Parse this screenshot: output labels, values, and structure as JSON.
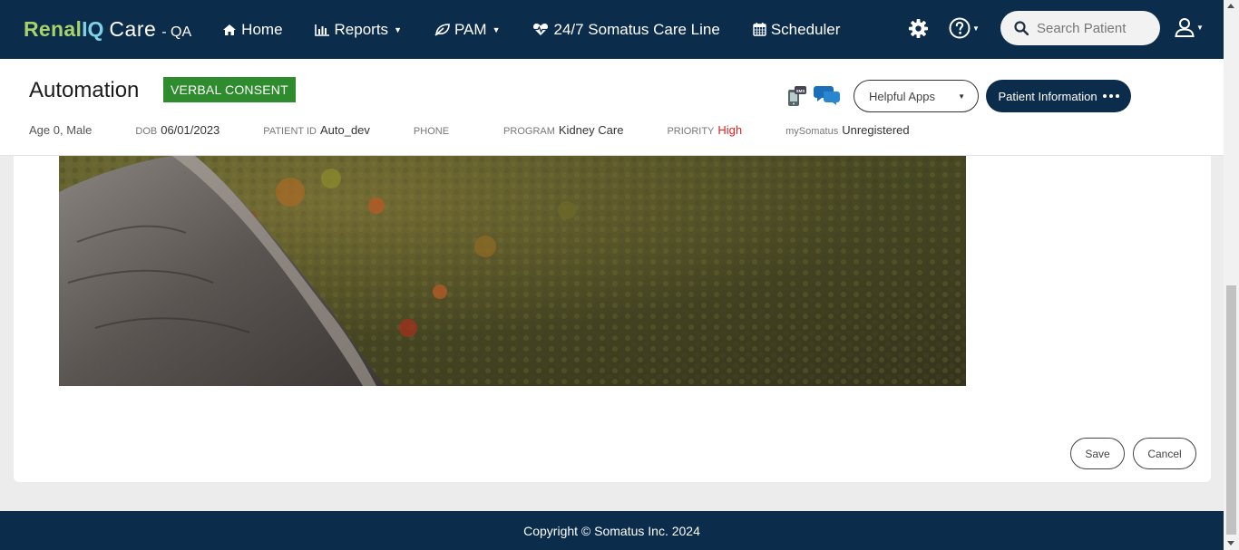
{
  "brand": {
    "renal": "Renal",
    "iq": "IQ",
    "care": "Care",
    "env": "- QA"
  },
  "nav": {
    "home": "Home",
    "reports": "Reports",
    "pam": "PAM",
    "careline": "24/7 Somatus Care Line",
    "scheduler": "Scheduler"
  },
  "search": {
    "placeholder": "Search Patient"
  },
  "patient": {
    "name": "Automation",
    "consent_badge": "VERBAL CONSENT",
    "helpful_apps": "Helpful Apps",
    "patient_info": "Patient Information",
    "sms_label": "SMS",
    "age_gender": "Age 0, Male",
    "dob_label": "DOB",
    "dob": "06/01/2023",
    "id_label": "PATIENT ID",
    "id": "Auto_dev",
    "phone_label": "PHONE",
    "phone": "",
    "program_label": "PROGRAM",
    "program": "Kidney Care",
    "priority_label": "PRIORITY",
    "priority": "High",
    "mysomatus_label": "mySomatus",
    "mysomatus": "Unregistered"
  },
  "actions": {
    "save": "Save",
    "cancel": "Cancel"
  },
  "footer": {
    "copyright": "Copyright © Somatus Inc. 2024"
  },
  "colors": {
    "nav_bg": "#0c2c4c",
    "brand_green": "#a8d26a",
    "brand_blue": "#7ed2e6",
    "consent_green": "#2e8b2e",
    "priority_red": "#e02020"
  }
}
